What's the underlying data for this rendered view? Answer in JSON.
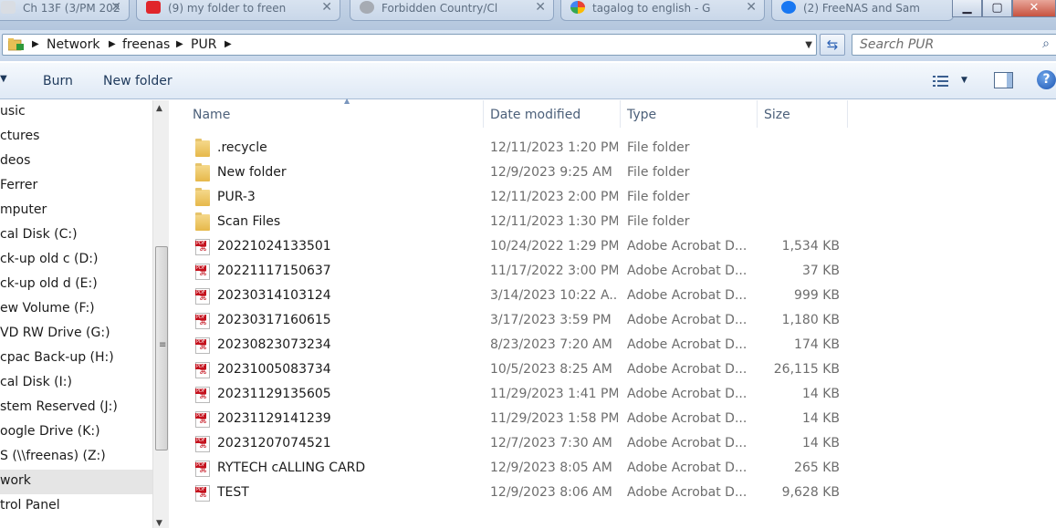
{
  "tabs": [
    {
      "title": "Ch 13F (3/PM 202"
    },
    {
      "title": "(9) my folder to freen"
    },
    {
      "title": "Forbidden Country/Cl"
    },
    {
      "title": "tagalog to english - G"
    },
    {
      "title": "(2) FreeNAS and Sam"
    }
  ],
  "address": {
    "crumbs": [
      "Network",
      "freenas",
      "PUR"
    ],
    "search_placeholder": "Search PUR"
  },
  "toolbar": {
    "burn": "Burn",
    "new_folder": "New folder"
  },
  "nav": {
    "items": [
      "usic",
      "ctures",
      "deos",
      "Ferrer",
      "mputer",
      "cal Disk (C:)",
      "ck-up old c (D:)",
      "ck-up old d (E:)",
      "ew Volume (F:)",
      "VD RW Drive (G:)",
      "cpac Back-up (H:)",
      "cal Disk (I:)",
      "stem Reserved (J:)",
      "oogle Drive (K:)",
      "S (\\\\freenas) (Z:)",
      "work",
      "trol Panel"
    ],
    "selected_index": 15
  },
  "columns": {
    "name": "Name",
    "date": "Date modified",
    "type": "Type",
    "size": "Size"
  },
  "files": [
    {
      "name": ".recycle",
      "date": "12/11/2023 1:20 PM",
      "type": "File folder",
      "size": "",
      "kind": "folder"
    },
    {
      "name": "New folder",
      "date": "12/9/2023 9:25 AM",
      "type": "File folder",
      "size": "",
      "kind": "folder"
    },
    {
      "name": "PUR-3",
      "date": "12/11/2023 2:00 PM",
      "type": "File folder",
      "size": "",
      "kind": "folder"
    },
    {
      "name": "Scan Files",
      "date": "12/11/2023 1:30 PM",
      "type": "File folder",
      "size": "",
      "kind": "folder"
    },
    {
      "name": "20221024133501",
      "date": "10/24/2022 1:29 PM",
      "type": "Adobe Acrobat D...",
      "size": "1,534 KB",
      "kind": "pdf"
    },
    {
      "name": "20221117150637",
      "date": "11/17/2022 3:00 PM",
      "type": "Adobe Acrobat D...",
      "size": "37 KB",
      "kind": "pdf"
    },
    {
      "name": "20230314103124",
      "date": "3/14/2023 10:22 A...",
      "type": "Adobe Acrobat D...",
      "size": "999 KB",
      "kind": "pdf"
    },
    {
      "name": "20230317160615",
      "date": "3/17/2023 3:59 PM",
      "type": "Adobe Acrobat D...",
      "size": "1,180 KB",
      "kind": "pdf"
    },
    {
      "name": "20230823073234",
      "date": "8/23/2023 7:20 AM",
      "type": "Adobe Acrobat D...",
      "size": "174 KB",
      "kind": "pdf"
    },
    {
      "name": "20231005083734",
      "date": "10/5/2023 8:25 AM",
      "type": "Adobe Acrobat D...",
      "size": "26,115 KB",
      "kind": "pdf"
    },
    {
      "name": "20231129135605",
      "date": "11/29/2023 1:41 PM",
      "type": "Adobe Acrobat D...",
      "size": "14 KB",
      "kind": "pdf"
    },
    {
      "name": "20231129141239",
      "date": "11/29/2023 1:58 PM",
      "type": "Adobe Acrobat D...",
      "size": "14 KB",
      "kind": "pdf"
    },
    {
      "name": "20231207074521",
      "date": "12/7/2023 7:30 AM",
      "type": "Adobe Acrobat D...",
      "size": "14 KB",
      "kind": "pdf"
    },
    {
      "name": "RYTECH cALLING CARD",
      "date": "12/9/2023 8:05 AM",
      "type": "Adobe Acrobat D...",
      "size": "265 KB",
      "kind": "pdf"
    },
    {
      "name": "TEST",
      "date": "12/9/2023 8:06 AM",
      "type": "Adobe Acrobat D...",
      "size": "9,628 KB",
      "kind": "pdf"
    }
  ],
  "colors": {
    "accent": "#1e395b",
    "selection": "#e5e5e5",
    "pdf_red": "#c4121e"
  }
}
